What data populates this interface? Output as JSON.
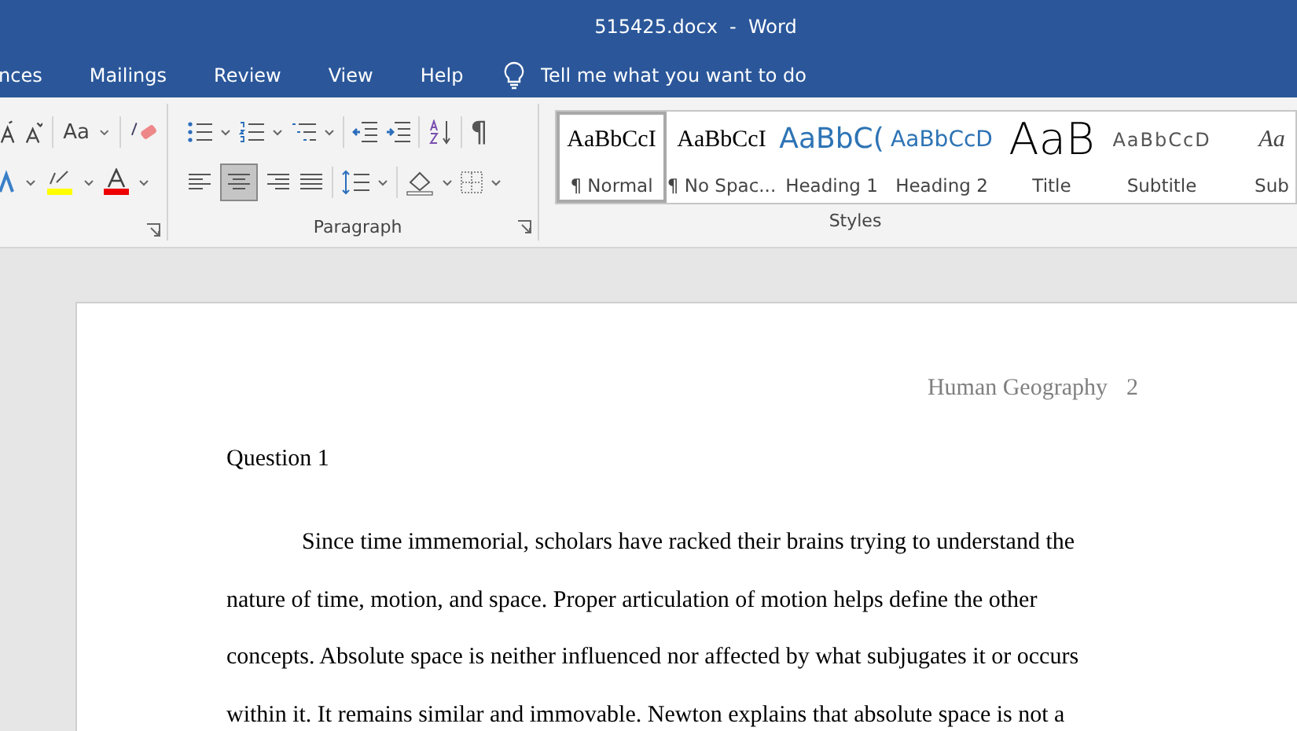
{
  "window": {
    "title": "515425.docx  -  Word"
  },
  "menu_tabs": [
    {
      "label": "nces",
      "selected": false
    },
    {
      "label": "Mailings",
      "selected": false
    },
    {
      "label": "Review",
      "selected": false
    },
    {
      "label": "View",
      "selected": false
    },
    {
      "label": "Help",
      "selected": false
    }
  ],
  "tell_me": {
    "placeholder": "Tell me what you want to do"
  },
  "ribbon": {
    "font_group": {
      "change_case": "Aa"
    },
    "paragraph_group": {
      "show_formatting": "¶",
      "label": "Paragraph",
      "align_center_selected": true
    },
    "styles_group": {
      "label": "Styles",
      "styles": [
        {
          "kind": "serif",
          "sample": "AaBbCcI",
          "label": "¶ Normal",
          "selected": true
        },
        {
          "kind": "serif",
          "sample": "AaBbCcI",
          "label": "¶ No Spac...",
          "selected": false
        },
        {
          "kind": "heading1",
          "sample": "AaBbC(",
          "label": "Heading 1",
          "selected": false
        },
        {
          "kind": "heading2",
          "sample": "AaBbCcD",
          "label": "Heading 2",
          "selected": false
        },
        {
          "kind": "title",
          "sample": "AaB",
          "label": "Title",
          "selected": false
        },
        {
          "kind": "subtitle",
          "sample": "AaBbCcD",
          "label": "Subtitle",
          "selected": false
        },
        {
          "kind": "emphasis",
          "sample": "Aa",
          "label": "Sub",
          "selected": false
        }
      ]
    }
  },
  "document": {
    "header": {
      "title": "Human Geography",
      "page_number": "2"
    },
    "heading": "Question 1",
    "paragraph": "Since time immemorial, scholars have racked their brains trying to understand the nature of time, motion, and space. Proper articulation of motion helps define the other concepts. Absolute space is neither influenced nor affected by what subjugates it or occurs within it. It remains similar and immovable. Newton explains that absolute space is not a"
  }
}
